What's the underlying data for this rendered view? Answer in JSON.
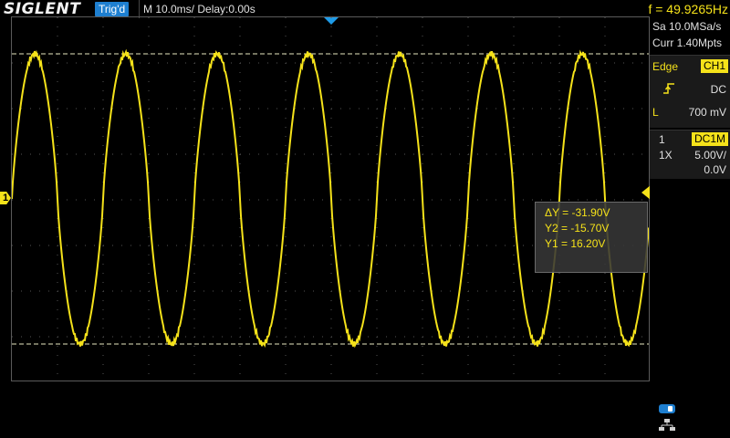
{
  "header": {
    "brand": "SIGLENT",
    "trigger_status": "Trig'd",
    "timebase": "M 10.0ms/ Delay:0.00s",
    "frequency": "f = 49.9265Hz"
  },
  "acquisition": {
    "sample_rate": "Sa 10.0MSa/s",
    "memory_depth": "Curr 1.40Mpts"
  },
  "trigger_panel": {
    "type": "Edge",
    "source": "CH1",
    "slope_icon": "rising-edge-icon",
    "coupling": "DC",
    "level_label": "L",
    "level": "700 mV"
  },
  "channel_panel": {
    "channel_number": "1",
    "coupling_impedance": "DC1M",
    "probe": "1X",
    "scale": "5.00V/",
    "offset": "0.0V"
  },
  "channel_marker": "1",
  "cursors": {
    "delta_y": "ΔY = -31.90V",
    "y2": "Y2 = -15.70V",
    "y1": "Y1 = 16.20V"
  },
  "colors": {
    "ch1": "#f5e21a",
    "accent": "#1e7fd0",
    "grid": "#6a6a6a"
  },
  "status_icons": [
    "usb-icon",
    "network-icon"
  ]
}
